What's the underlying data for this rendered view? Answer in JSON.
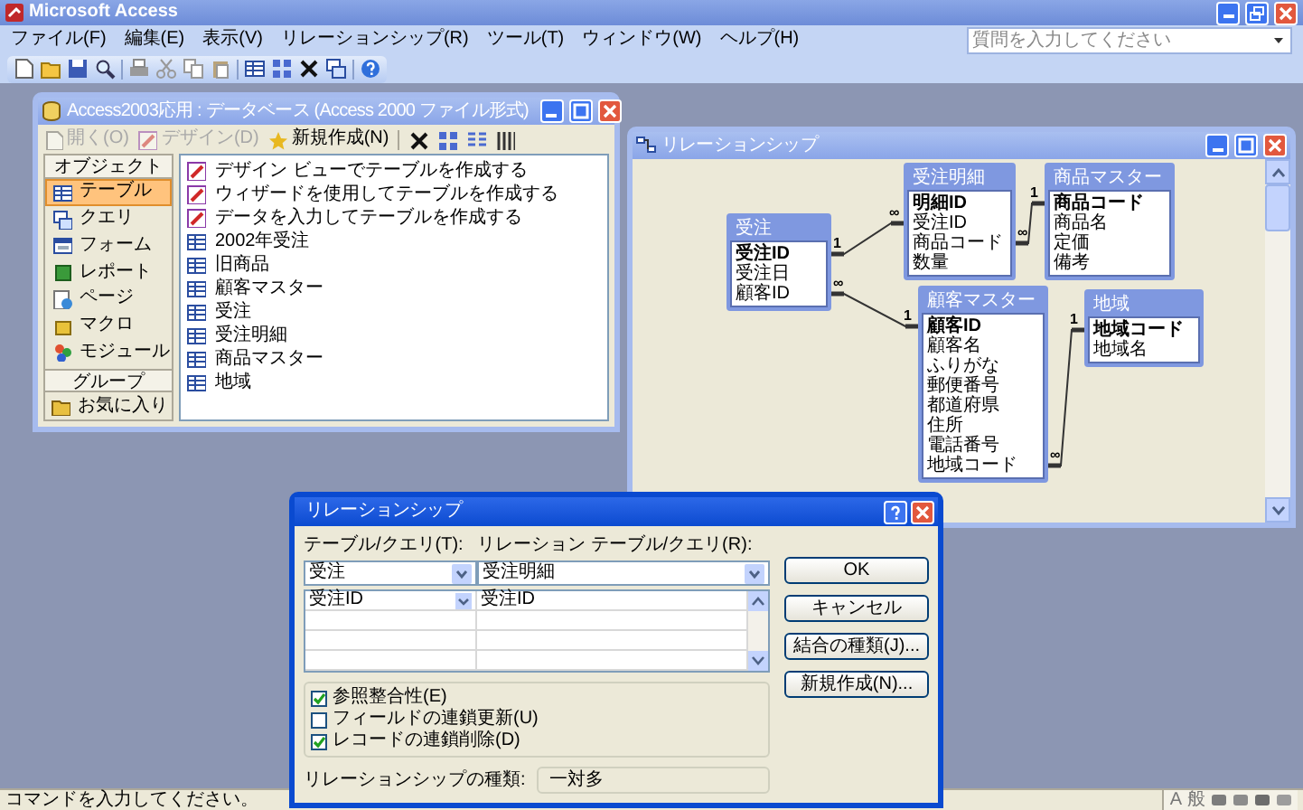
{
  "app": {
    "title": "Microsoft Access",
    "menus": [
      "ファイル(F)",
      "編集(E)",
      "表示(V)",
      "リレーションシップ(R)",
      "ツール(T)",
      "ウィンドウ(W)",
      "ヘルプ(H)"
    ],
    "help_box": {
      "placeholder": "質問を入力してください"
    }
  },
  "database_window": {
    "title": "Access2003応用 : データベース (Access 2000 ファイル形式)",
    "toolbar": [
      {
        "label": "開く(O)",
        "disabled": true
      },
      {
        "label": "デザイン(D)",
        "disabled": true
      },
      {
        "label": "新規作成(N)",
        "disabled": false
      }
    ],
    "objects_header": "オブジェクト",
    "objects": [
      {
        "label": "テーブル",
        "selected": true
      },
      {
        "label": "クエリ",
        "selected": false
      },
      {
        "label": "フォーム",
        "selected": false
      },
      {
        "label": "レポート",
        "selected": false
      },
      {
        "label": "ページ",
        "selected": false
      },
      {
        "label": "マクロ",
        "selected": false
      },
      {
        "label": "モジュール",
        "selected": false
      }
    ],
    "groups_header": "グループ",
    "groups": [
      "お気に入り"
    ],
    "items": [
      {
        "label": "デザイン ビューでテーブルを作成する",
        "kind": "shortcut"
      },
      {
        "label": "ウィザードを使用してテーブルを作成する",
        "kind": "shortcut"
      },
      {
        "label": "データを入力してテーブルを作成する",
        "kind": "shortcut"
      },
      {
        "label": "2002年受注",
        "kind": "table"
      },
      {
        "label": "旧商品",
        "kind": "table"
      },
      {
        "label": "顧客マスター",
        "kind": "table"
      },
      {
        "label": "受注",
        "kind": "table"
      },
      {
        "label": "受注明細",
        "kind": "table"
      },
      {
        "label": "商品マスター",
        "kind": "table"
      },
      {
        "label": "地域",
        "kind": "table"
      }
    ]
  },
  "relationships_window": {
    "title": "リレーションシップ",
    "tables": [
      {
        "name": "受注",
        "fields": [
          {
            "name": "受注ID",
            "primary_key": true
          },
          {
            "name": "受注日",
            "primary_key": false
          },
          {
            "name": "顧客ID",
            "primary_key": false
          }
        ]
      },
      {
        "name": "受注明細",
        "fields": [
          {
            "name": "明細ID",
            "primary_key": true
          },
          {
            "name": "受注ID",
            "primary_key": false
          },
          {
            "name": "商品コード",
            "primary_key": false
          },
          {
            "name": "数量",
            "primary_key": false
          }
        ]
      },
      {
        "name": "商品マスター",
        "fields": [
          {
            "name": "商品コード",
            "primary_key": true
          },
          {
            "name": "商品名",
            "primary_key": false
          },
          {
            "name": "定価",
            "primary_key": false
          },
          {
            "name": "備考",
            "primary_key": false
          }
        ]
      },
      {
        "name": "顧客マスター",
        "fields": [
          {
            "name": "顧客ID",
            "primary_key": true
          },
          {
            "name": "顧客名",
            "primary_key": false
          },
          {
            "name": "ふりがな",
            "primary_key": false
          },
          {
            "name": "郵便番号",
            "primary_key": false
          },
          {
            "name": "都道府県",
            "primary_key": false
          },
          {
            "name": "住所",
            "primary_key": false
          },
          {
            "name": "電話番号",
            "primary_key": false
          },
          {
            "name": "地域コード",
            "primary_key": false
          }
        ]
      },
      {
        "name": "地域",
        "fields": [
          {
            "name": "地域コード",
            "primary_key": true
          },
          {
            "name": "地域名",
            "primary_key": false
          }
        ]
      }
    ],
    "joins": [
      {
        "from_end": "1",
        "to_end": "∞"
      },
      {
        "from_end": "∞",
        "to_end": "1"
      },
      {
        "from_end": "∞",
        "to_end": "1"
      },
      {
        "from_end": "∞",
        "to_end": "1"
      }
    ]
  },
  "dialog": {
    "title": "リレーションシップ",
    "table_label": "テーブル/クエリ(T):",
    "related_label": "リレーション テーブル/クエリ(R):",
    "table": "受注",
    "related_table": "受注明細",
    "field_rows": [
      [
        "受注ID",
        "受注ID"
      ]
    ],
    "options": [
      {
        "label": "参照整合性(E)",
        "checked": true
      },
      {
        "label": "フィールドの連鎖更新(U)",
        "checked": false
      },
      {
        "label": "レコードの連鎖削除(D)",
        "checked": true
      }
    ],
    "type_label": "リレーションシップの種類:",
    "type": "一対多",
    "buttons": [
      "OK",
      "キャンセル",
      "結合の種類(J)...",
      "新規作成(N)..."
    ]
  },
  "status_bar": {
    "message": "コマンドを入力してください。",
    "ime": [
      "A",
      "般"
    ]
  }
}
